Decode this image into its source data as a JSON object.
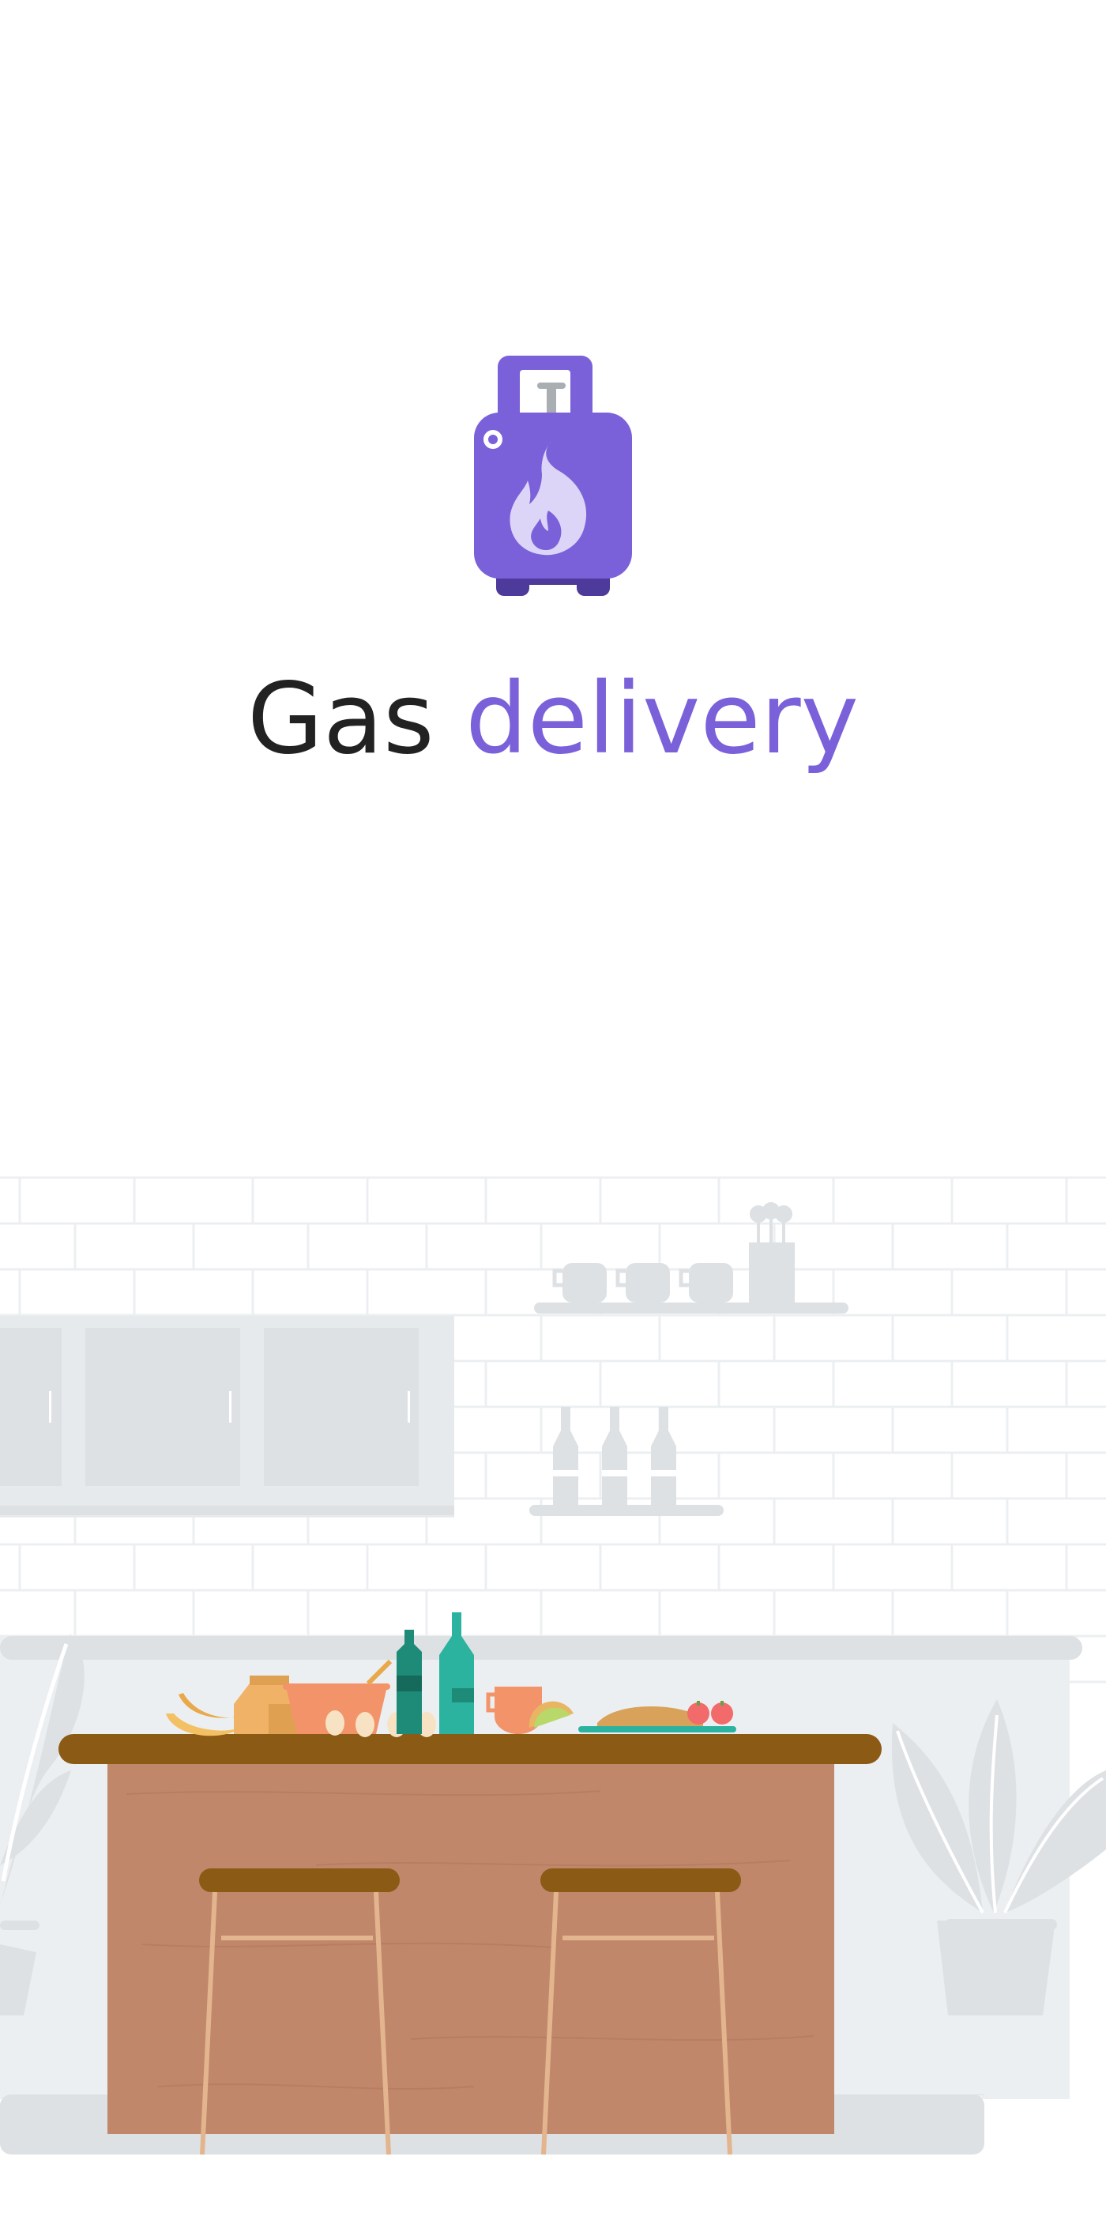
{
  "splash": {
    "title_part1": "Gas",
    "title_part2": "delivery"
  },
  "icons": {
    "logo": "gas-cylinder-flame-icon"
  },
  "colors": {
    "brand_purple": "#7b61d9",
    "brand_purple_dark": "#4e3a9a",
    "flame_light": "#ddd5f7",
    "title_dark": "#222222",
    "wall_line": "#eceff1",
    "fixture_grey": "#dde1e4",
    "counter_top": "#8b5a14",
    "counter_body": "#c0876a",
    "stool_leg": "#e3b58e"
  }
}
